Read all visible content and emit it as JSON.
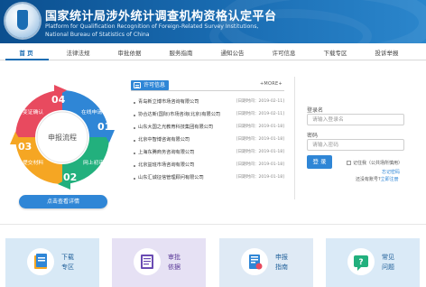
{
  "header": {
    "title": "国家统计局涉外统计调查机构资格认定平台",
    "subtitle_line1": "Platform for Qualification Recognition of Foreign-Related Survey Institutions,",
    "subtitle_line2": "National Bureau of Statistics of China"
  },
  "nav": [
    {
      "label": "首 页",
      "active": true
    },
    {
      "label": "法律法规",
      "active": false
    },
    {
      "label": "审批依据",
      "active": false
    },
    {
      "label": "服务指南",
      "active": false
    },
    {
      "label": "通知公告",
      "active": false
    },
    {
      "label": "许可信息",
      "active": false
    },
    {
      "label": "下载专区",
      "active": false
    },
    {
      "label": "投诉举报",
      "active": false
    }
  ],
  "cycle": {
    "center": "申报流程",
    "steps": [
      {
        "num": "04",
        "label": "变证确认",
        "color": "#e84a5f"
      },
      {
        "num": "01",
        "label": "在线申请",
        "color": "#2f86d6"
      },
      {
        "num": "02",
        "label": "网上初审",
        "color": "#22b07d"
      },
      {
        "num": "03",
        "label": "提交材料",
        "color": "#f5a623"
      }
    ],
    "button": "点击查看详情"
  },
  "notice": {
    "tag": "许可信息",
    "more": "+MORE+",
    "items": [
      {
        "title": "青岛新立博市场咨询有限公司",
        "date": "[日期时间：2019-02-11]"
      },
      {
        "title": "协合达新(国际)市场咨询(北京)有限公司",
        "date": "[日期时间：2019-02-11]"
      },
      {
        "title": "山东大国之光教育科技集团有限公司",
        "date": "[日期时间：2019-01-18]"
      },
      {
        "title": "北京中智博咨询有限公司",
        "date": "[日期时间：2019-01-18]"
      },
      {
        "title": "上海东腾商务咨询有限公司",
        "date": "[日期时间：2019-01-18]"
      },
      {
        "title": "北京益班市场咨询有限公司",
        "date": "[日期时间：2019-01-18]"
      },
      {
        "title": "山东汇诚征信管理顾问有限公司",
        "date": "[日期时间：2019-01-18]"
      }
    ]
  },
  "login": {
    "username_label": "登录名",
    "username_placeholder": "请输入登录名",
    "password_label": "密码",
    "password_placeholder": "请输入密码",
    "submit": "登 录",
    "remember": "记住我（公共场所慎用）",
    "forgot": "忘记密码",
    "register_prefix": "还没有账号?",
    "register_link": "立即注册"
  },
  "cards": [
    {
      "label_line1": "下载",
      "label_line2": "专区",
      "icon": "folder-icon"
    },
    {
      "label_line1": "审批",
      "label_line2": "依据",
      "icon": "book-icon"
    },
    {
      "label_line1": "申报",
      "label_line2": "指南",
      "icon": "document-icon"
    },
    {
      "label_line1": "常见",
      "label_line2": "问题",
      "icon": "question-icon"
    }
  ]
}
